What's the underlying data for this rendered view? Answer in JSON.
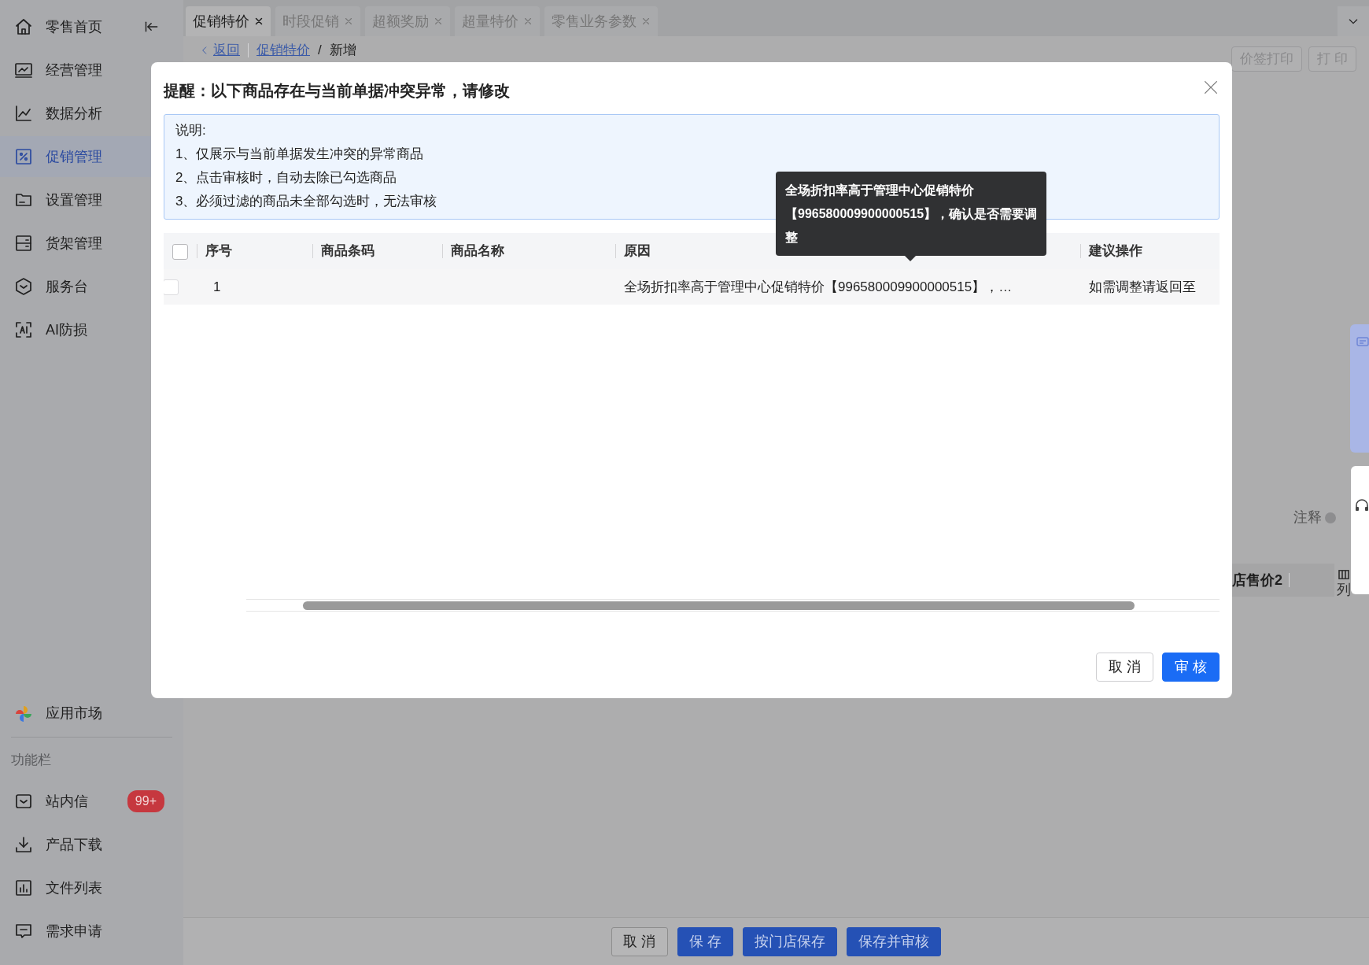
{
  "sidebar": {
    "items": [
      {
        "label": "零售首页",
        "selected": false
      },
      {
        "label": "经营管理",
        "selected": false
      },
      {
        "label": "数据分析",
        "selected": false
      },
      {
        "label": "促销管理",
        "selected": true
      },
      {
        "label": "设置管理",
        "selected": false
      },
      {
        "label": "货架管理",
        "selected": false
      },
      {
        "label": "服务台",
        "selected": false
      },
      {
        "label": "AI防损",
        "selected": false
      }
    ],
    "app_market": "应用市场",
    "section_title": "功能栏",
    "tools": [
      {
        "label": "站内信",
        "badge": "99+"
      },
      {
        "label": "产品下载"
      },
      {
        "label": "文件列表"
      },
      {
        "label": "需求申请"
      }
    ]
  },
  "tabs": [
    {
      "label": "促销特价",
      "selected": true
    },
    {
      "label": "时段促销",
      "selected": false
    },
    {
      "label": "超额奖励",
      "selected": false
    },
    {
      "label": "超量特价",
      "selected": false
    },
    {
      "label": "零售业务参数",
      "selected": false
    }
  ],
  "breadcrumb": {
    "back": "返回",
    "parent": "促销特价",
    "separator": "/",
    "current": "新增"
  },
  "page_actions": [
    "价签打印",
    "打 印"
  ],
  "background": {
    "note": "注释",
    "column_header": "店售价2",
    "columns_button": "列"
  },
  "footer_buttons": [
    {
      "label": "取 消",
      "kind": "default"
    },
    {
      "label": "保 存",
      "kind": "primary"
    },
    {
      "label": "按门店保存",
      "kind": "primary"
    },
    {
      "label": "保存并审核",
      "kind": "primary"
    }
  ],
  "modal": {
    "title": "提醒：以下商品存在与当前单据冲突异常，请修改",
    "notice": [
      "说明:",
      "1、仅展示与当前单据发生冲突的异常商品",
      "2、点击审核时，自动去除已勾选商品",
      "3、必须过滤的商品未全部勾选时，无法审核"
    ],
    "table": {
      "all_checked": false,
      "columns": [
        "序号",
        "商品条码",
        "商品名称",
        "原因",
        "建议操作"
      ],
      "rows": [
        {
          "checked": false,
          "index": "1",
          "reason": "全场折扣率高于管理中心促销特价【996580009900000515】，…",
          "suggestion": "如需调整请返回至"
        }
      ]
    },
    "tooltip": "全场折扣率高于管理中心促销特价【996580009900000515】，确认是否需要调整",
    "buttons": [
      {
        "label": "取 消",
        "kind": "default"
      },
      {
        "label": "审 核",
        "kind": "primary"
      }
    ]
  }
}
